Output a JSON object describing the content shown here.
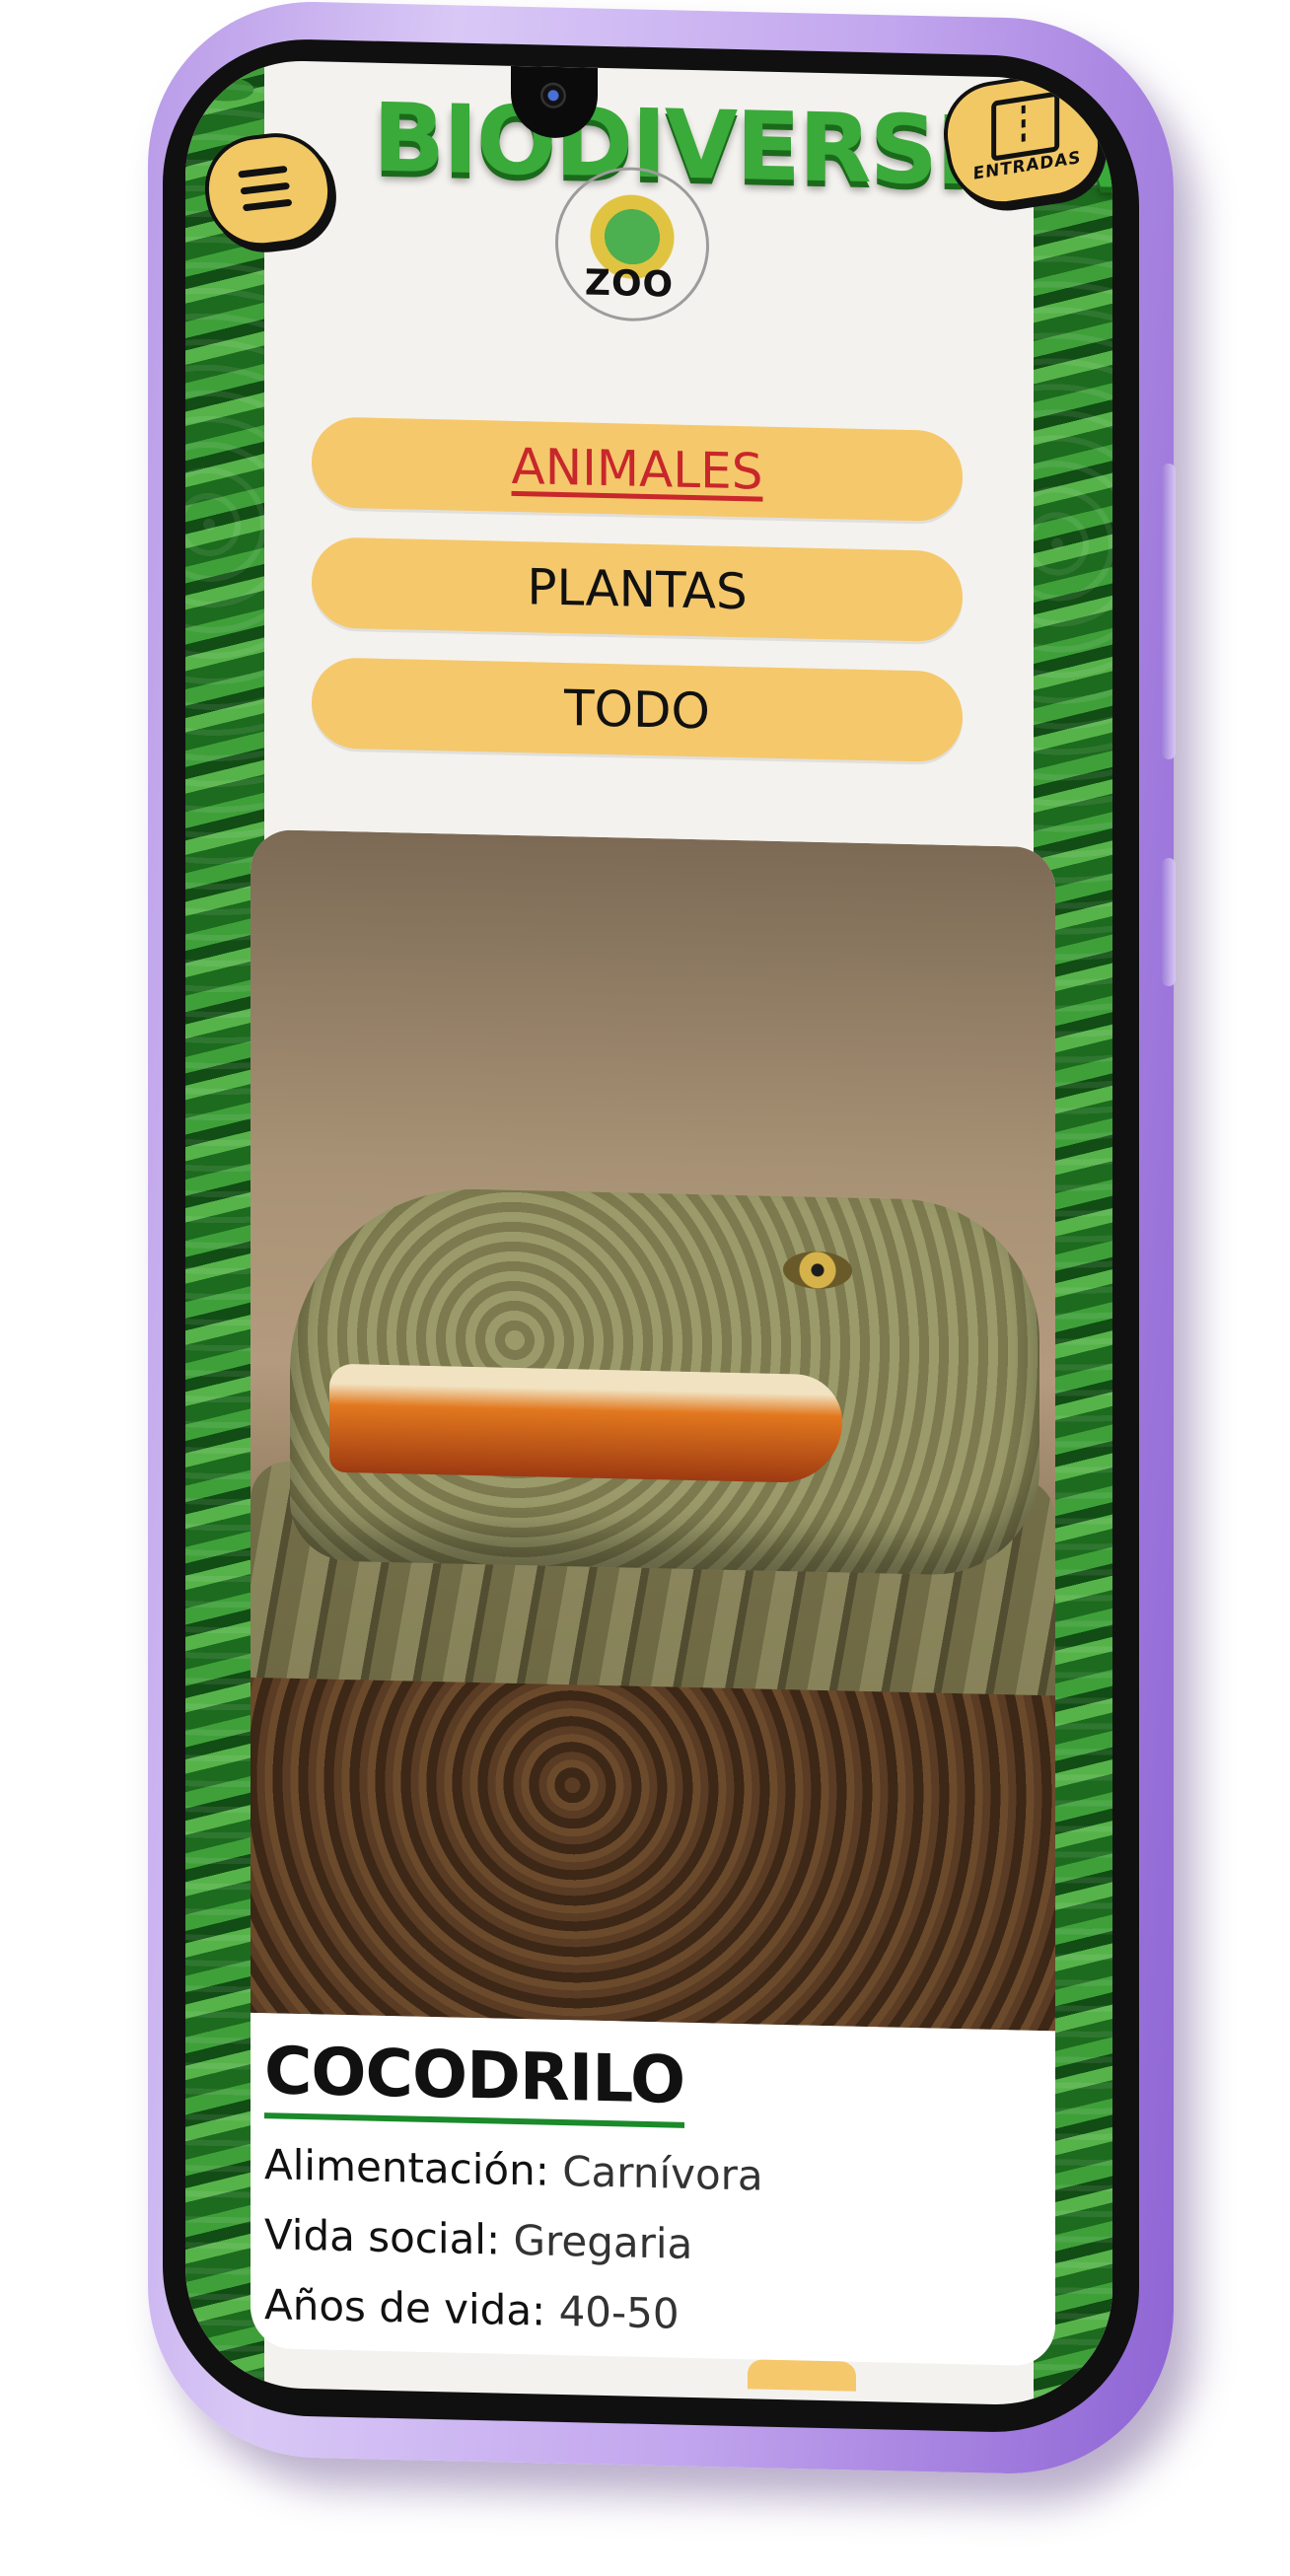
{
  "header": {
    "brand_word": "BIODIVERSIDAD",
    "zoo_label": "ZOO",
    "tickets_label": "ENTRADAS"
  },
  "icons": {
    "menu": "hamburger-menu-icon",
    "tickets": "ticket-icon",
    "camera": "front-camera"
  },
  "filters": [
    {
      "label": "ANIMALES",
      "active": true
    },
    {
      "label": "PLANTAS",
      "active": false
    },
    {
      "label": "TODO",
      "active": false
    }
  ],
  "animal": {
    "name": "COCODRILO",
    "facts": [
      {
        "label": "Alimentación:",
        "value": "Carnívora"
      },
      {
        "label": "Vida social:",
        "value": "Gregaria"
      },
      {
        "label": "Años de vida:",
        "value": "40-50"
      }
    ]
  },
  "colors": {
    "accent_yellow": "#f5c86c",
    "active_red": "#c8272b",
    "underline_green": "#1a8a2a",
    "phone_purple": "#b99be8"
  }
}
